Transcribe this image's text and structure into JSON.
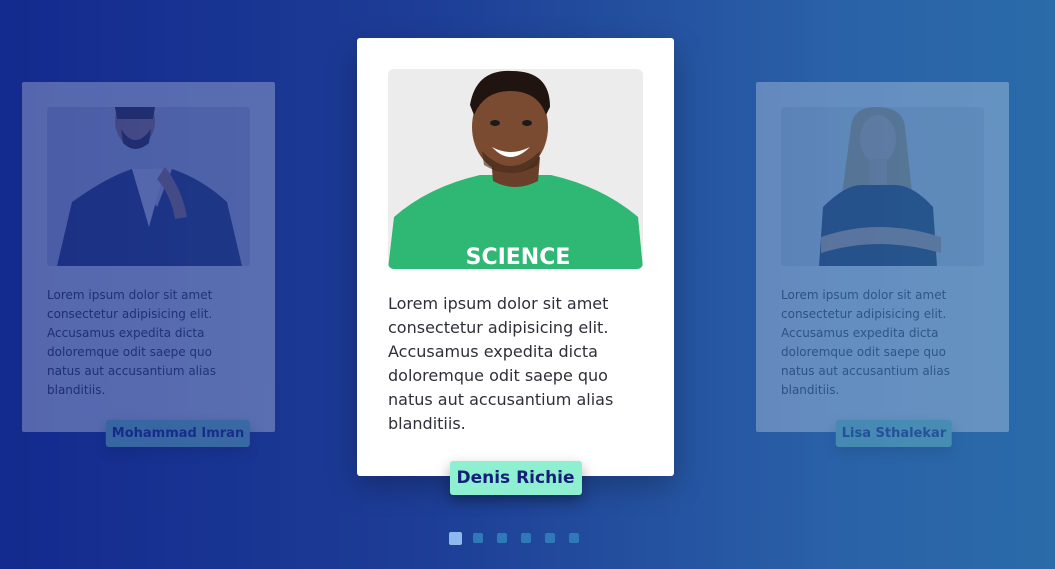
{
  "testimonials": [
    {
      "name": "Mohammad Imran",
      "quote": "Lorem ipsum dolor sit amet consectetur adipisicing elit. Accusamus expedita dicta doloremque odit saepe quo natus aut accusantium alias blanditiis."
    },
    {
      "name": "Denis Richie",
      "quote": "Lorem ipsum dolor sit amet consectetur adipisicing elit. Accusamus expedita dicta doloremque odit saepe quo natus aut accusantium alias blanditiis."
    },
    {
      "name": "Lisa Sthalekar",
      "quote": "Lorem ipsum dolor sit amet consectetur adipisicing elit. Accusamus expedita dicta doloremque odit saepe quo natus aut accusantium alias blanditiis."
    }
  ],
  "pagination": {
    "total": 6,
    "active_index": 0
  },
  "colors": {
    "background_start": "#132a8e",
    "background_end": "#2a6ba9",
    "name_tag_bg": "#8ef0d0",
    "name_tag_text": "#151f7a",
    "dot_active": "#8db9ee",
    "dot_inactive": "#2f79b9"
  }
}
